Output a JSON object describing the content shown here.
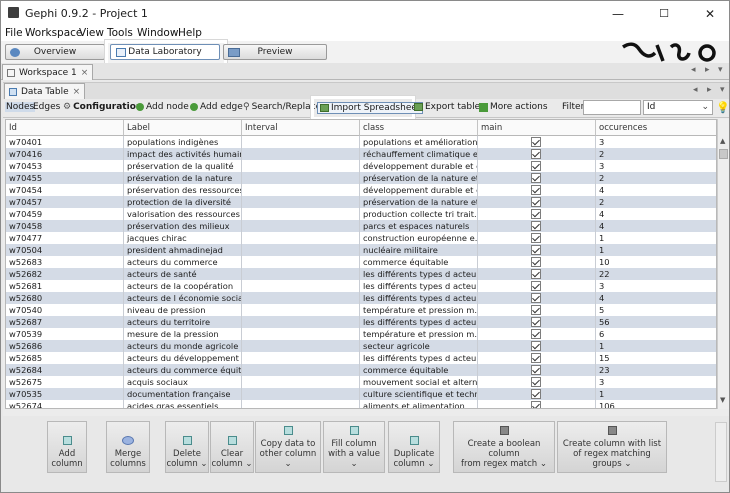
{
  "window": {
    "title": "Gephi 0.9.2 - Project 1",
    "controls": [
      "—",
      "☐",
      "✕"
    ]
  },
  "menubar": [
    "File",
    "Workspace",
    "View",
    "Tools",
    "Window",
    "Help"
  ],
  "modes": {
    "overview": "Overview",
    "data_laboratory": "Data Laboratory",
    "preview": "Preview"
  },
  "workspace_tab": "Workspace 1",
  "data_table_tab": "Data Table",
  "toolbar": {
    "nodes": "Nodes",
    "edges": "Edges",
    "configuration": "Configuration",
    "add_node": "Add node",
    "add_edge": "Add edge",
    "search_replace": "Search/Replace",
    "import_spreadsheet": "Import Spreadsheet",
    "export_table": "Export table",
    "more_actions": "More actions",
    "filter_label": "Filter:",
    "filter_value": "",
    "filter_column": "Id"
  },
  "table": {
    "columns": [
      "Id",
      "Label",
      "Interval",
      "class",
      "main",
      "occurences"
    ],
    "rows": [
      [
        "w70401",
        "populations indigènes",
        "",
        "populations et amélioration ...",
        true,
        "3"
      ],
      [
        "w70416",
        "impact des activités humaines",
        "",
        "réchauffement climatique et...",
        true,
        "2"
      ],
      [
        "w70453",
        "préservation de la qualité",
        "",
        "développement durable et e...",
        true,
        "3"
      ],
      [
        "w70455",
        "préservation de la nature",
        "",
        "préservation de la nature et...",
        true,
        "2"
      ],
      [
        "w70454",
        "préservation des ressources...",
        "",
        "développement durable et e...",
        true,
        "4"
      ],
      [
        "w70457",
        "protection de la diversité",
        "",
        "préservation de la nature et...",
        true,
        "2"
      ],
      [
        "w70459",
        "valorisation des ressources",
        "",
        "production collecte tri trait...",
        true,
        "4"
      ],
      [
        "w70458",
        "préservation des milieux",
        "",
        "parcs et espaces naturels",
        true,
        "4"
      ],
      [
        "w70477",
        "jacques chirac",
        "",
        "construction européenne e...",
        true,
        "1"
      ],
      [
        "w70504",
        "president ahmadinejad",
        "",
        "nucléaire militaire",
        true,
        "1"
      ],
      [
        "w52683",
        "acteurs du commerce",
        "",
        "commerce équitable",
        true,
        "10"
      ],
      [
        "w52682",
        "acteurs de santé",
        "",
        "les différents types d acteur...",
        true,
        "22"
      ],
      [
        "w52681",
        "acteurs de la coopération",
        "",
        "les différents types d acteur...",
        true,
        "3"
      ],
      [
        "w52680",
        "acteurs de l économie sociale",
        "",
        "les différents types d acteur...",
        true,
        "4"
      ],
      [
        "w70540",
        "niveau de pression",
        "",
        "température et pression m...",
        true,
        "5"
      ],
      [
        "w52687",
        "acteurs du territoire",
        "",
        "les différents types d acteur...",
        true,
        "56"
      ],
      [
        "w70539",
        "mesure de la pression",
        "",
        "température et pression m...",
        true,
        "6"
      ],
      [
        "w52686",
        "acteurs du monde agricole",
        "",
        "secteur agricole",
        true,
        "1"
      ],
      [
        "w52685",
        "acteurs du développement",
        "",
        "les différents types d acteur...",
        true,
        "15"
      ],
      [
        "w52684",
        "acteurs du commerce équit...",
        "",
        "commerce équitable",
        true,
        "23"
      ],
      [
        "w52675",
        "acquis sociaux",
        "",
        "mouvement social et alterna...",
        true,
        "3"
      ],
      [
        "w70535",
        "documentation française",
        "",
        "culture scientifique et techni...",
        true,
        "1"
      ],
      [
        "w52674",
        "acides gras essentiels",
        "",
        "aliments et alimentation",
        true,
        "106"
      ]
    ]
  },
  "bottom_buttons": [
    {
      "label1": "Add",
      "label2": "column"
    },
    {
      "label1": "Merge",
      "label2": "columns"
    },
    {
      "label1": "Delete",
      "label2": "column ⌄"
    },
    {
      "label1": "Clear",
      "label2": "column ⌄"
    },
    {
      "label1": "Copy data to",
      "label2": "other column ⌄"
    },
    {
      "label1": "Fill column",
      "label2": "with a value ⌄"
    },
    {
      "label1": "Duplicate",
      "label2": "column ⌄"
    },
    {
      "label1": "Create a boolean column",
      "label2": "from regex match ⌄"
    },
    {
      "label1": "Create column with list",
      "label2": "of regex matching groups ⌄"
    }
  ]
}
